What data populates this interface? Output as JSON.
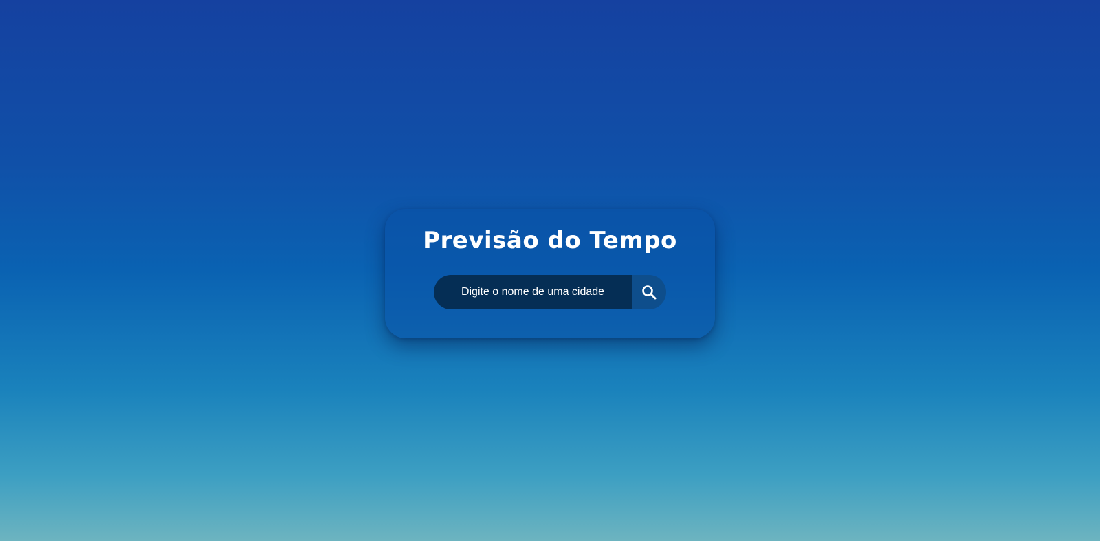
{
  "app": {
    "title": "Previsão do Tempo"
  },
  "search": {
    "placeholder": "Digite o nome de uma cidade",
    "value": "",
    "button_icon": "search-icon"
  },
  "colors": {
    "background_top": "#1541a0",
    "background_bottom": "#6db4c0",
    "input_background": "#052e55",
    "button_background": "#0e4e8c",
    "text": "#ffffff"
  }
}
